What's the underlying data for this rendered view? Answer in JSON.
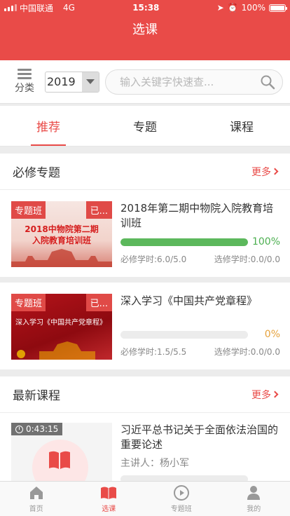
{
  "status": {
    "carrier": "中国联通",
    "network": "4G",
    "time": "15:38",
    "battery": "100%"
  },
  "header": {
    "title": "选课"
  },
  "filter": {
    "category_label": "分类",
    "year": "2019",
    "search_placeholder": "输入关键字快速查..."
  },
  "tabs": [
    {
      "label": "推荐",
      "active": true
    },
    {
      "label": "专题"
    },
    {
      "label": "课程"
    }
  ],
  "required": {
    "title": "必修专题",
    "more": "更多",
    "items": [
      {
        "badge": "专题班",
        "badge_right": "已...",
        "thumb_text_1": "2018中物院第二期",
        "thumb_text_2": "入院教育培训班",
        "title": "2018年第二期中物院入院教育培训班",
        "progress": 1.0,
        "progress_text": "100%",
        "required_hours": "必修学时:6.0/5.0",
        "elective_hours": "选修学时:0.0/0.0"
      },
      {
        "badge": "专题班",
        "badge_right": "已...",
        "thumb_text_1": "深入学习《中国共产党章程》",
        "title": "深入学习《中国共产党章程》",
        "progress": 0.0,
        "progress_text": "0%",
        "required_hours": "必修学时:1.5/5.5",
        "elective_hours": "选修学时:0.0/0.0"
      }
    ]
  },
  "latest": {
    "title": "最新课程",
    "more": "更多",
    "items": [
      {
        "duration": "0:43:15",
        "title": "习近平总书记关于全面依法治国的重要论述",
        "lecturer": "主讲人：杨小军"
      }
    ]
  },
  "tabbar": [
    {
      "label": "首页",
      "icon": "home-icon"
    },
    {
      "label": "选课",
      "icon": "book-icon",
      "active": true
    },
    {
      "label": "专题班",
      "icon": "play-icon"
    },
    {
      "label": "我的",
      "icon": "user-icon"
    }
  ],
  "colors": {
    "primary": "#e94b48",
    "progress_green": "#5cb85c",
    "progress_orange": "#e6a23c"
  }
}
